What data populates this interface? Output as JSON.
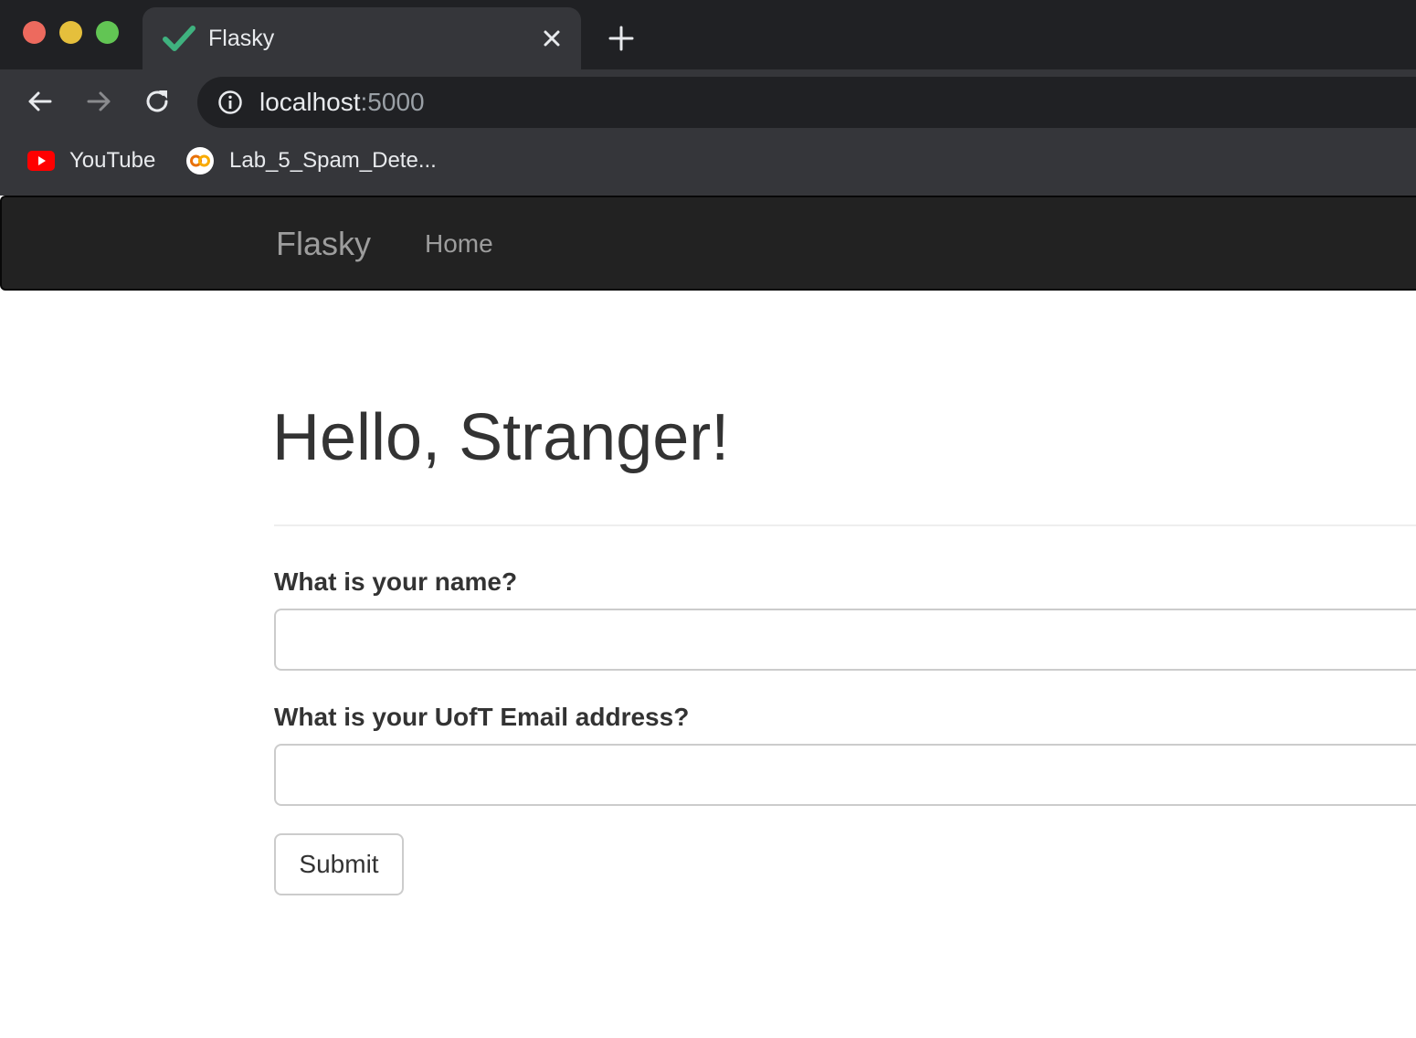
{
  "browser": {
    "tab": {
      "title": "Flasky",
      "favicon": "check-icon",
      "favicon_color": "#3fb27f"
    },
    "address_bar": {
      "host": "localhost",
      "port": ":5000"
    },
    "bookmarks": [
      {
        "label": "YouTube",
        "icon": "youtube-icon",
        "color": "#ff0000"
      },
      {
        "label": "Lab_5_Spam_Dete...",
        "icon": "colab-icon",
        "color": "#f9ab00"
      }
    ]
  },
  "navbar": {
    "brand": "Flasky",
    "links": [
      {
        "label": "Home"
      }
    ]
  },
  "main": {
    "heading": "Hello, Stranger!",
    "form": {
      "name_label": "What is your name?",
      "name_value": "",
      "email_label": "What is your UofT Email address?",
      "email_value": "",
      "submit_label": "Submit"
    }
  }
}
